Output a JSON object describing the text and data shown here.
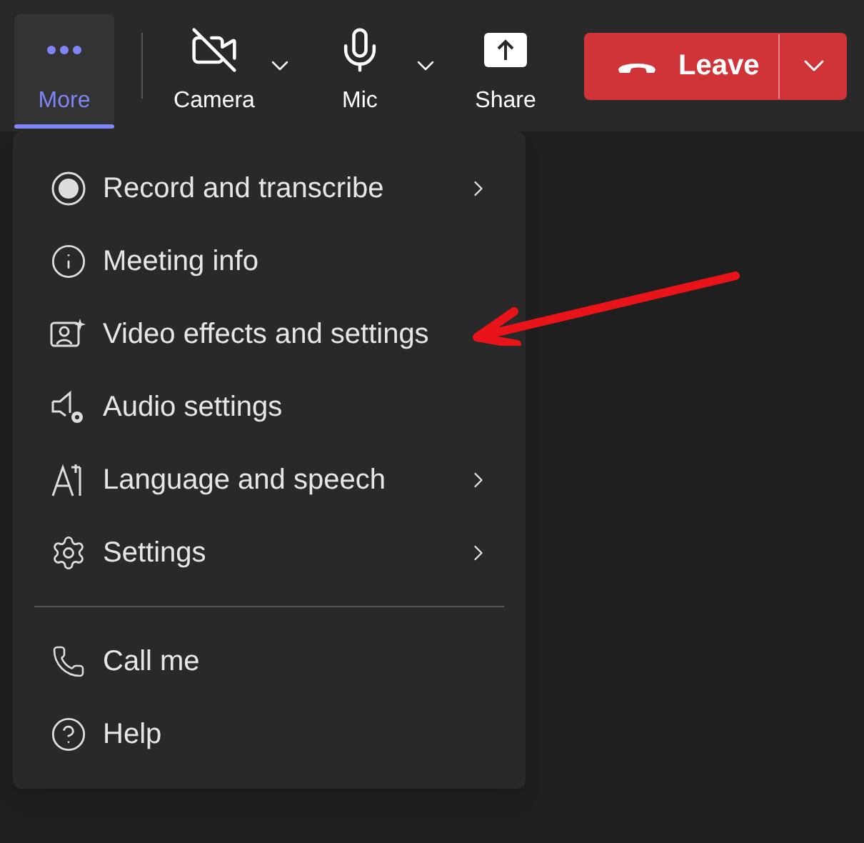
{
  "toolbar": {
    "items": [
      {
        "label": "More",
        "selected": true,
        "dropdown": false
      },
      {
        "label": "Camera",
        "selected": false,
        "dropdown": true
      },
      {
        "label": "Mic",
        "selected": false,
        "dropdown": true
      },
      {
        "label": "Share",
        "selected": false,
        "dropdown": false
      }
    ],
    "leave": {
      "label": "Leave"
    }
  },
  "menu": {
    "groups": [
      [
        {
          "label": "Record and transcribe",
          "submenu": true
        },
        {
          "label": "Meeting info",
          "submenu": false
        },
        {
          "label": "Video effects and settings",
          "submenu": false
        },
        {
          "label": "Audio settings",
          "submenu": false
        },
        {
          "label": "Language and speech",
          "submenu": true
        },
        {
          "label": "Settings",
          "submenu": true
        }
      ],
      [
        {
          "label": "Call me",
          "submenu": false
        },
        {
          "label": "Help",
          "submenu": false
        }
      ]
    ]
  }
}
